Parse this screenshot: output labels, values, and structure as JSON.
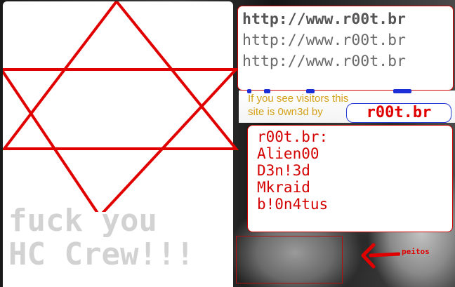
{
  "colors": {
    "accent_red": "#e00000",
    "url_gray": "#6a6a6a",
    "visitor_gold": "#d4a017",
    "crew_gray": "#d2d2d2",
    "badge_border_blue": "#2a3bd6"
  },
  "left_panel": {
    "symbol_icon": "hexagram-icon",
    "crew_lines": [
      "fuck you",
      "HC Crew!!!"
    ]
  },
  "url_box": {
    "lines": [
      "http://www.r00t.br",
      "http://www.r00t.br",
      "http://www.r00t.br"
    ]
  },
  "visitor_message": {
    "line1": "If you see visitors this",
    "line2": "site is 0wn3d by",
    "brand": "r00t.br"
  },
  "members": {
    "lines": [
      "r00t.br:",
      "Alien00",
      "D3n!3d",
      "Mkraid",
      "b!0n4tus"
    ]
  },
  "annotation": {
    "arrow_icon": "arrow-left-icon",
    "label": "peitos"
  }
}
